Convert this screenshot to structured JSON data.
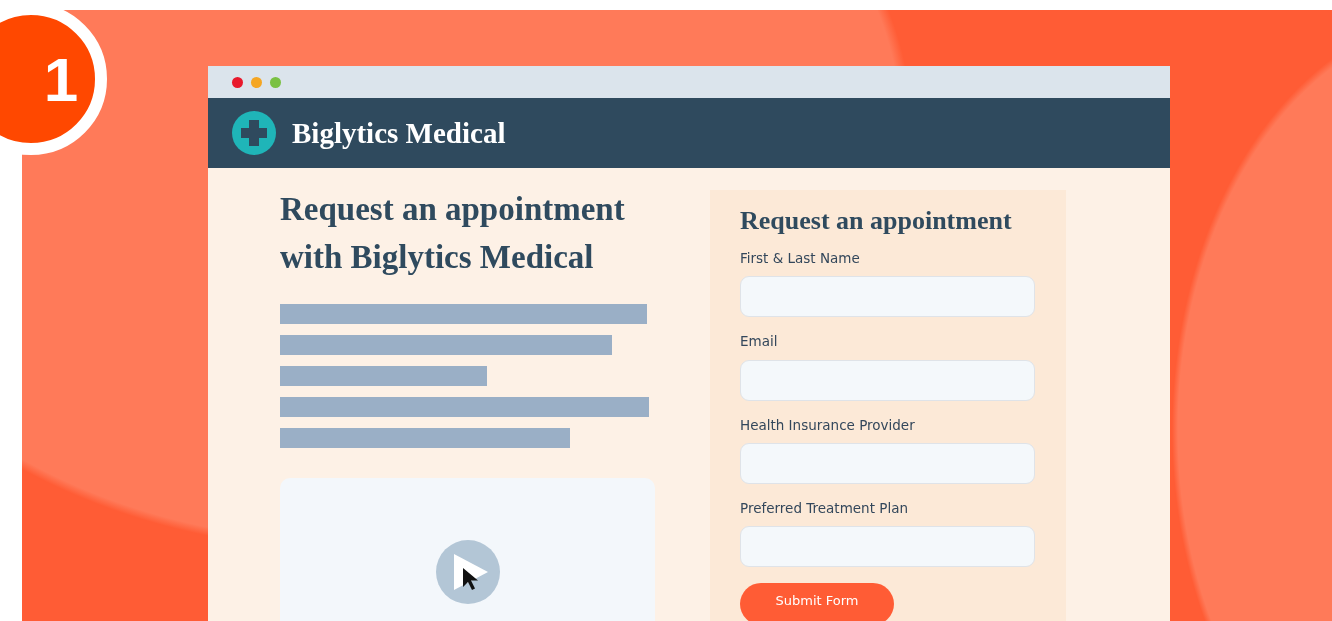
{
  "badge": {
    "number": "1"
  },
  "browser": {
    "window_controls": [
      {
        "color": "#e8192c"
      },
      {
        "color": "#f5a623"
      },
      {
        "color": "#7ac143"
      }
    ],
    "header": {
      "brand": "Biglytics Medical"
    },
    "hero": {
      "title": "Request an appointment with Biglytics Medical"
    },
    "form": {
      "title": "Request an appointment",
      "fields": [
        {
          "label": "First & Last Name"
        },
        {
          "label": "Email"
        },
        {
          "label": "Health Insurance Provider"
        },
        {
          "label": "Preferred Treatment Plan"
        }
      ],
      "submit": "Submit Form"
    }
  }
}
